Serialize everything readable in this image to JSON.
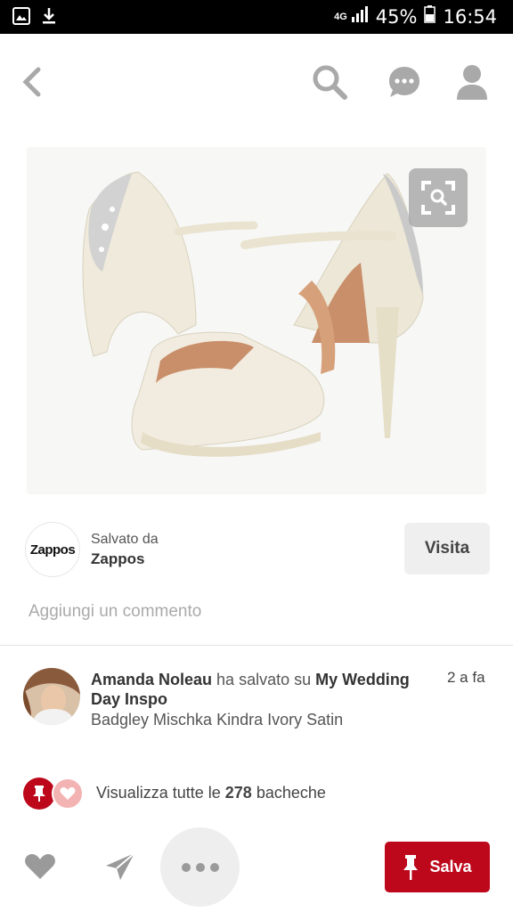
{
  "status_bar": {
    "network": "4G",
    "battery": "45%",
    "time": "16:54"
  },
  "icons": {
    "back": "chevron-left-icon",
    "search": "search-icon",
    "messages": "chat-bubble-icon",
    "profile": "person-icon",
    "visual_search": "visual-search-icon",
    "like": "heart-icon",
    "send": "send-icon",
    "more": "more-dots-icon",
    "pin": "pushpin-icon"
  },
  "colors": {
    "save_red": "#bd081c",
    "nav_gray": "#a9a9a9"
  },
  "source": {
    "logo_text": "Zappos",
    "saved_from_label": "Salvato da",
    "name": "Zappos",
    "visit_label": "Visita"
  },
  "comment": {
    "placeholder": "Aggiungi un commento"
  },
  "pinner": {
    "name": "Amanda Noleau",
    "action": "ha salvato su",
    "board": "My Wedding Day Inspo",
    "description": "Badgley Mischka Kindra Ivory Satin",
    "time": "2 a fa"
  },
  "boards": {
    "prefix": "Visualizza tutte le",
    "count": "278",
    "suffix": "bacheche"
  },
  "actions": {
    "save_label": "Salva"
  }
}
